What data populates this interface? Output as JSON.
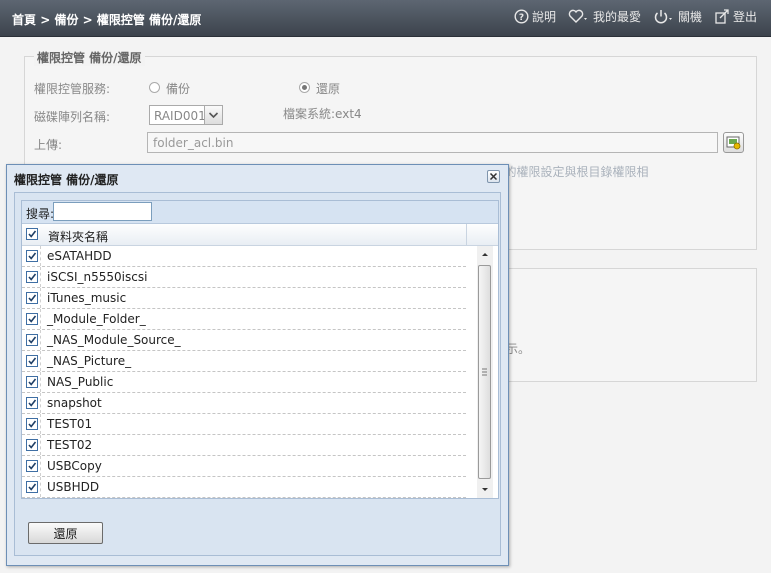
{
  "topbar": {
    "breadcrumb": [
      "首頁",
      "備份",
      "權限控管 備份/還原"
    ],
    "separator": " > ",
    "nav": {
      "help": "說明",
      "favorites": "我的最愛",
      "shutdown": "關機",
      "logout": "登出"
    }
  },
  "page": {
    "legend": "權限控管 備份/還原",
    "service_label": "權限控管服務:",
    "option_backup": "備份",
    "option_restore": "還原",
    "selected_option": "還原",
    "raid_label": "磁碟陣列名稱:",
    "raid_value": "RAID001",
    "filesystem": "檔案系統:ext4",
    "upload_label": "上傳:",
    "upload_value": "folder_acl.bin",
    "hidden_note_1": "( 將會花費數多時間進行權限控管的還原。因為將會將子目錄或檔案的權限設定與根目錄權限相",
    "hidden_note_2": "示。"
  },
  "modal": {
    "title": "權限控管 備份/還原",
    "search_label": "搜尋:",
    "search_value": "",
    "column_header": "資料夾名稱",
    "folders": [
      "eSATAHDD",
      "iSCSI_n5550iscsi",
      "iTunes_music",
      "_Module_Folder_",
      "_NAS_Module_Source_",
      "_NAS_Picture_",
      "NAS_Public",
      "snapshot",
      "TEST01",
      "TEST02",
      "USBCopy",
      "USBHDD"
    ],
    "all_checked": true,
    "restore_button": "還原"
  },
  "colors": {
    "topbar": "#4a525c",
    "modal_bg": "#dfe8f3",
    "checkbox_border": "#3f6fa4"
  }
}
